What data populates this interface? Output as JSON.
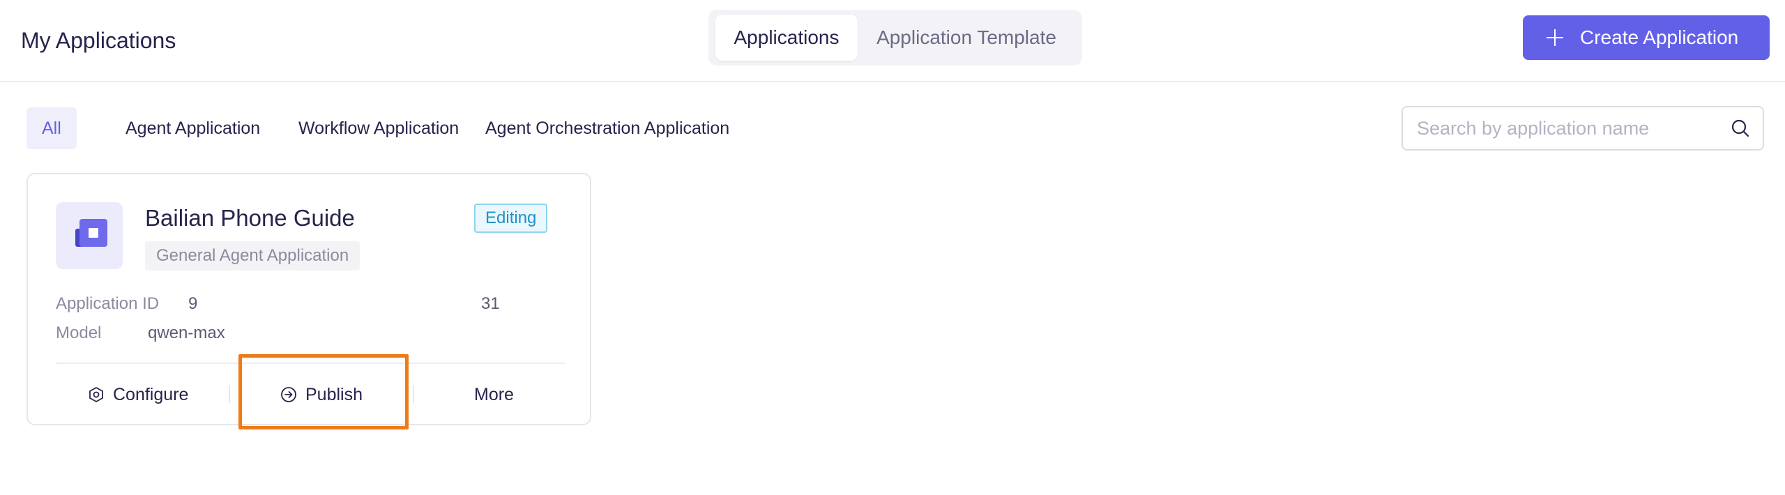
{
  "header": {
    "title": "My Applications",
    "view_tabs": [
      {
        "label": "Applications",
        "active": true
      },
      {
        "label": "Application Template",
        "active": false
      }
    ],
    "create_button_label": "Create Application"
  },
  "filters": {
    "items": [
      {
        "label": "All",
        "active": true
      },
      {
        "label": "Agent Application",
        "active": false
      },
      {
        "label": "Workflow Application",
        "active": false
      },
      {
        "label": "Agent Orchestration Application",
        "active": false
      }
    ]
  },
  "search": {
    "placeholder": "Search by application name",
    "value": ""
  },
  "apps": [
    {
      "name": "Bailian Phone Guide",
      "type": "General Agent Application",
      "status": "Editing",
      "app_id_label": "Application ID",
      "app_id_start": "9",
      "app_id_end": "31",
      "model_label": "Model",
      "model": "qwen-max",
      "actions": {
        "configure": "Configure",
        "publish": "Publish",
        "more": "More"
      }
    }
  ],
  "colors": {
    "accent": "#6360e8",
    "highlight": "#f07a15",
    "status_editing": "#1f92c4"
  },
  "icons": {
    "create": "plus-icon",
    "search": "search-icon",
    "configure": "hexagon-gear-icon",
    "publish": "circle-arrow-right-icon"
  }
}
